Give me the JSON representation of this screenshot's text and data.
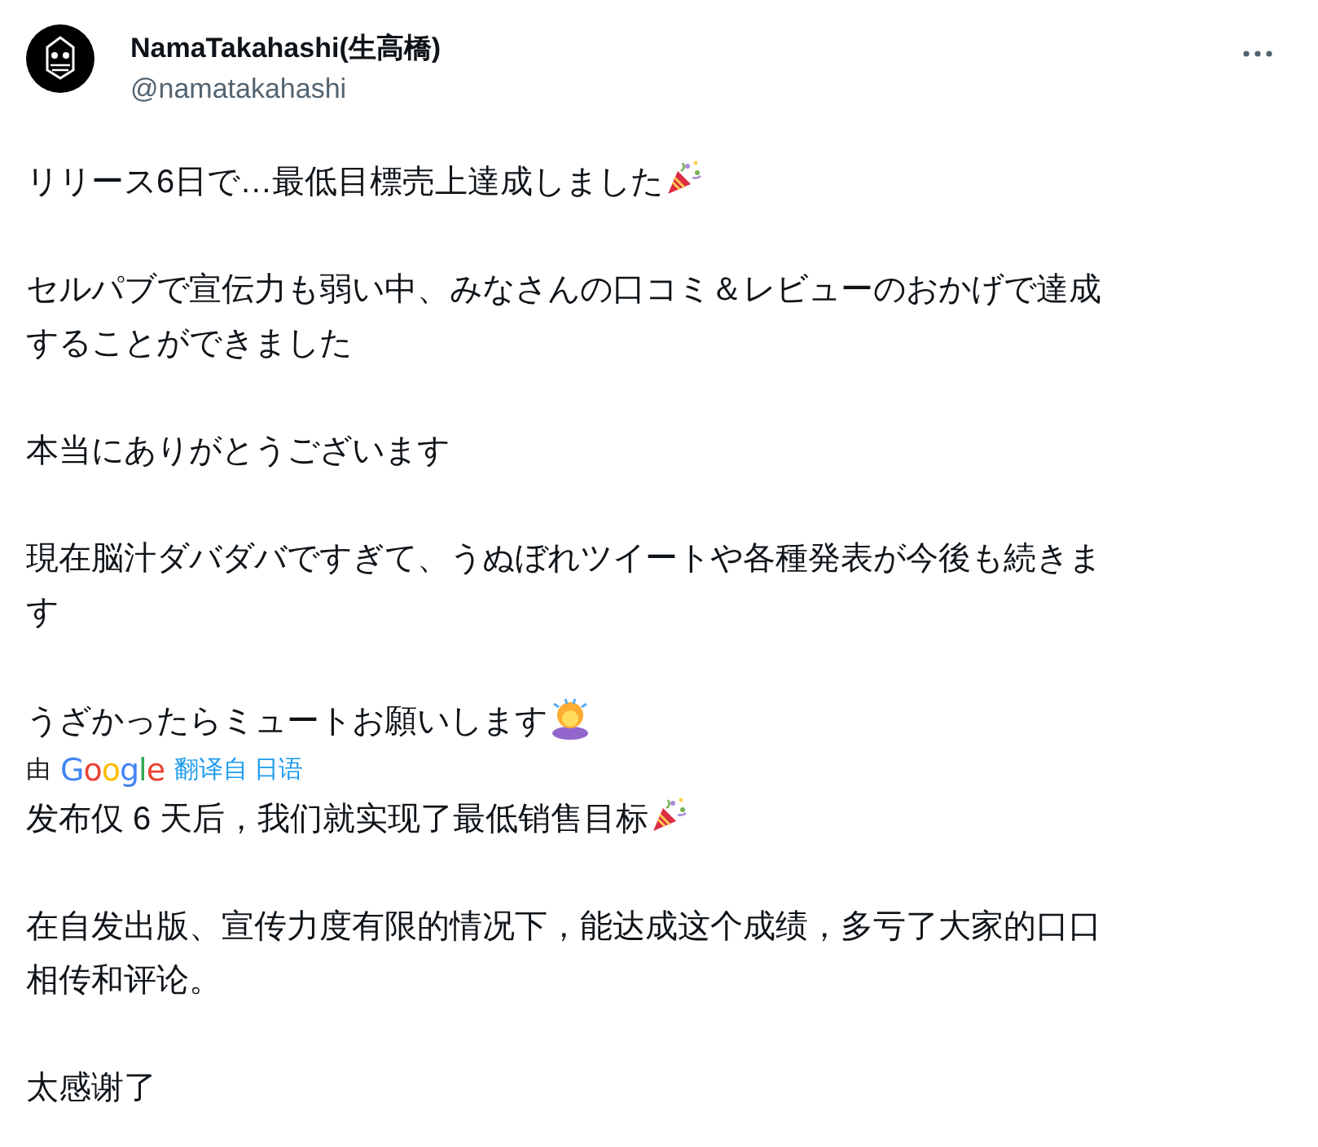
{
  "author": {
    "name": "NamaTakahashi(生高橋)",
    "handle": "@namatakahashi"
  },
  "original": [
    {
      "lines": [
        "リリース6日で…最低目標売上達成しました"
      ],
      "kind": "party"
    },
    {
      "lines": [
        "セルパブで宣伝力も弱い中、みなさんの口コミ＆レビューのおかげで達成",
        "することができました"
      ],
      "kind": "plain"
    },
    {
      "lines": [
        "本当にありがとうございます"
      ],
      "kind": "plain"
    },
    {
      "lines": [
        "現在脳汁ダバダバですぎて、うぬぼれツイートや各種発表が今後も続きま",
        "す"
      ],
      "kind": "plain"
    },
    {
      "lines": [
        "うざかったらミュートお願いします"
      ],
      "kind": "bow"
    }
  ],
  "translation": {
    "prefix": "由",
    "provider": "Google",
    "link": "翻译自 日语"
  },
  "translated": [
    {
      "lines": [
        "发布仅 6 天后，我们就实现了最低销售目标"
      ],
      "kind": "party"
    },
    {
      "lines": [
        "在自发出版、宣传力度有限的情况下，能达成这个成绩，多亏了大家的口口",
        "相传和评论。"
      ],
      "kind": "plain"
    },
    {
      "lines": [
        "太感谢了"
      ],
      "kind": "plain"
    }
  ]
}
